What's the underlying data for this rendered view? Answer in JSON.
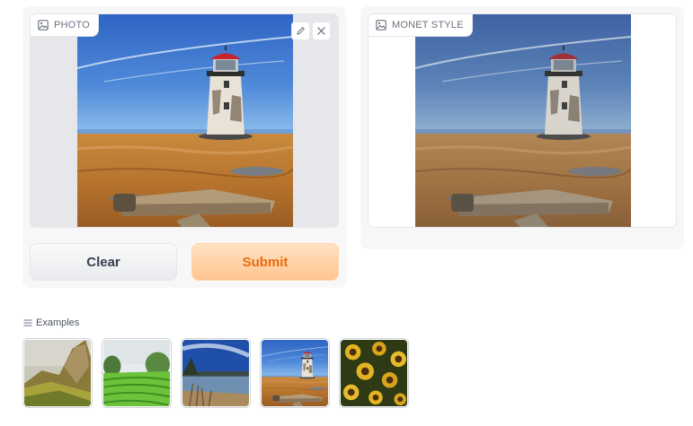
{
  "input": {
    "label": "PHOTO",
    "label_icon": "image-icon",
    "tools": [
      "pencil-edit-icon",
      "close-icon"
    ]
  },
  "output": {
    "label": "MONET STYLE",
    "label_icon": "image-icon"
  },
  "buttons": {
    "clear_label": "Clear",
    "submit_label": "Submit"
  },
  "examples": {
    "label": "Examples",
    "label_icon": "list-icon",
    "items": [
      {
        "name": "example-rocky-hillside"
      },
      {
        "name": "example-green-tea-field"
      },
      {
        "name": "example-lake-reeds"
      },
      {
        "name": "example-lighthouse-beach"
      },
      {
        "name": "example-sunflowers"
      }
    ]
  },
  "colors": {
    "submit_bg": "#ffd4a8",
    "submit_text": "#ea6a0c",
    "clear_bg": "#f0f1f3",
    "panel_bg": "#f7f7f8"
  }
}
